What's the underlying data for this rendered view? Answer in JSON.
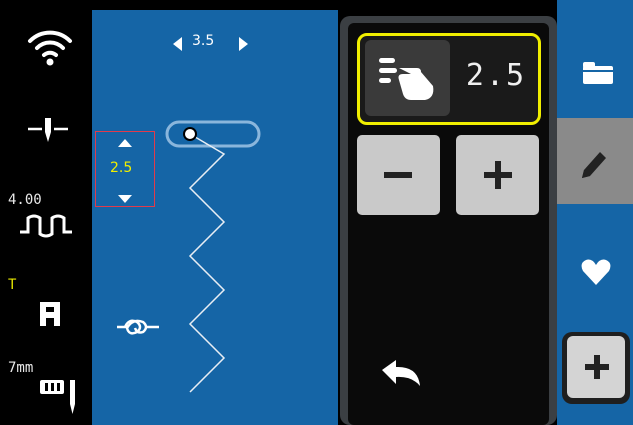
{
  "left_status": {
    "wifi_icon": "wifi-icon",
    "needle_icon": "needle-position-icon",
    "tension_value": "4.00",
    "tension_icon": "thread-tension-icon",
    "foot_letter": "T",
    "presser_foot_icon": "presser-foot-icon",
    "needle_size": "7mm",
    "twin_needle_icon": "twin-needle-icon"
  },
  "canvas": {
    "stitch_length": "3.5",
    "stitch_width": "2.5",
    "tieoff_icon": "tie-off-icon"
  },
  "panel": {
    "value": "2.5",
    "hand_icon": "manual-adjust-icon",
    "minus_label": "−",
    "plus_label": "+",
    "back_icon": "undo-arrow-icon"
  },
  "right_toolbar": {
    "items": [
      "folder-icon",
      "pencil-icon",
      "heart-icon"
    ],
    "add_label": "+"
  },
  "colors": {
    "canvas_blue": "#1565a6",
    "highlight_yellow": "#f0ee00",
    "selection_red": "#e23b4b"
  }
}
